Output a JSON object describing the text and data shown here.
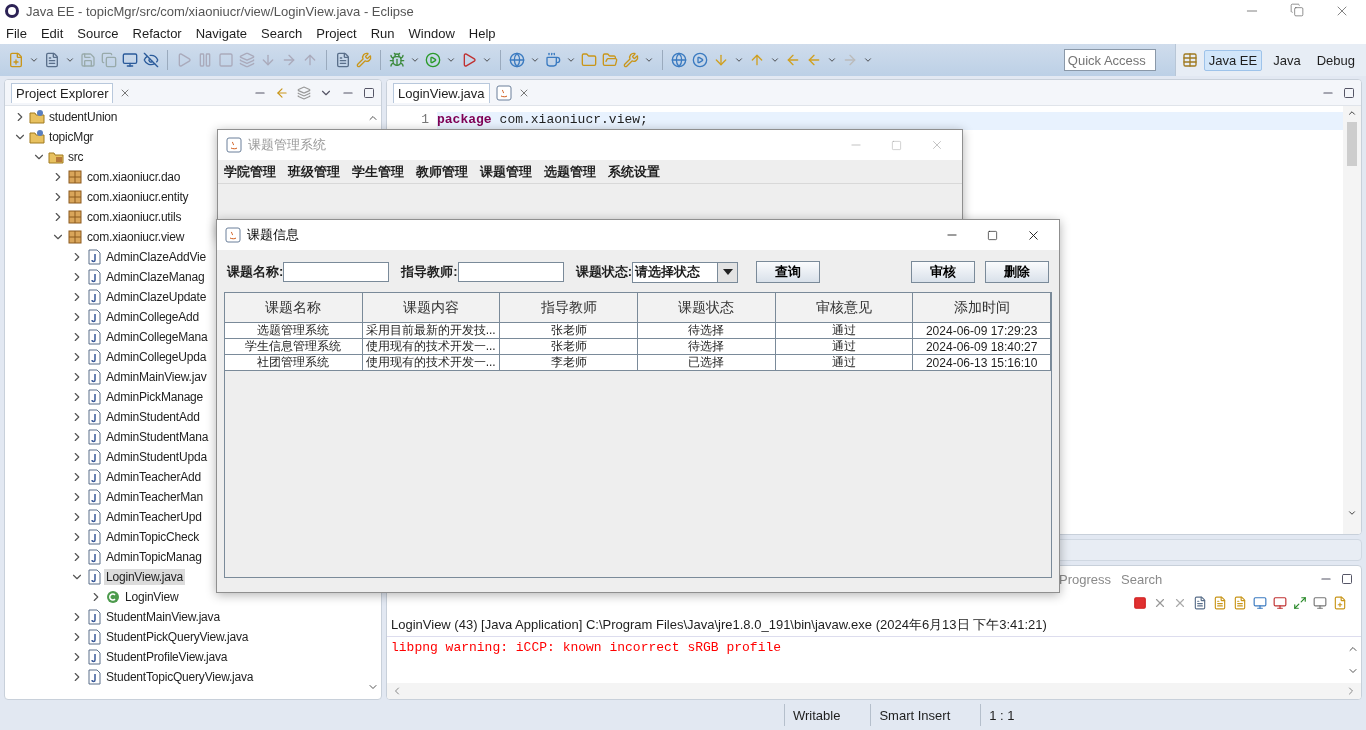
{
  "window": {
    "title": "Java EE - topicMgr/src/com/xiaoniucr/view/LoginView.java - Eclipse"
  },
  "menu": [
    "File",
    "Edit",
    "Source",
    "Refactor",
    "Navigate",
    "Search",
    "Project",
    "Run",
    "Window",
    "Help"
  ],
  "quick_access": {
    "placeholder": "Quick Access"
  },
  "perspectives": [
    {
      "label": "Java EE",
      "selected": true
    },
    {
      "label": "Java",
      "selected": false
    },
    {
      "label": "Debug",
      "selected": false
    }
  ],
  "project_explorer": {
    "title": "Project Explorer",
    "tree": [
      {
        "label": "studentUnion",
        "kind": "project",
        "expanded": false,
        "selected": false
      },
      {
        "label": "topicMgr",
        "kind": "project",
        "expanded": true,
        "selected": false,
        "children": [
          {
            "label": "src",
            "kind": "source-folder",
            "expanded": true,
            "selected": false,
            "children": [
              {
                "label": "com.xiaoniucr.dao",
                "kind": "package",
                "expanded": false,
                "selected": false
              },
              {
                "label": "com.xiaoniucr.entity",
                "kind": "package",
                "expanded": false,
                "selected": false
              },
              {
                "label": "com.xiaoniucr.utils",
                "kind": "package",
                "expanded": false,
                "selected": false
              },
              {
                "label": "com.xiaoniucr.view",
                "kind": "package",
                "expanded": true,
                "selected": false,
                "children": [
                  {
                    "label": "AdminClazeAddVie",
                    "kind": "java-file",
                    "expanded": false,
                    "selected": false
                  },
                  {
                    "label": "AdminClazeManag",
                    "kind": "java-file",
                    "expanded": false,
                    "selected": false
                  },
                  {
                    "label": "AdminClazeUpdate",
                    "kind": "java-file",
                    "expanded": false,
                    "selected": false
                  },
                  {
                    "label": "AdminCollegeAdd",
                    "kind": "java-file",
                    "expanded": false,
                    "selected": false
                  },
                  {
                    "label": "AdminCollegeMana",
                    "kind": "java-file",
                    "expanded": false,
                    "selected": false
                  },
                  {
                    "label": "AdminCollegeUpda",
                    "kind": "java-file",
                    "expanded": false,
                    "selected": false
                  },
                  {
                    "label": "AdminMainView.jav",
                    "kind": "java-file",
                    "expanded": false,
                    "selected": false
                  },
                  {
                    "label": "AdminPickManage",
                    "kind": "java-file",
                    "expanded": false,
                    "selected": false
                  },
                  {
                    "label": "AdminStudentAdd",
                    "kind": "java-file",
                    "expanded": false,
                    "selected": false
                  },
                  {
                    "label": "AdminStudentMana",
                    "kind": "java-file",
                    "expanded": false,
                    "selected": false
                  },
                  {
                    "label": "AdminStudentUpda",
                    "kind": "java-file",
                    "expanded": false,
                    "selected": false
                  },
                  {
                    "label": "AdminTeacherAdd",
                    "kind": "java-file",
                    "expanded": false,
                    "selected": false
                  },
                  {
                    "label": "AdminTeacherMan",
                    "kind": "java-file",
                    "expanded": false,
                    "selected": false
                  },
                  {
                    "label": "AdminTeacherUpd",
                    "kind": "java-file",
                    "expanded": false,
                    "selected": false
                  },
                  {
                    "label": "AdminTopicCheck",
                    "kind": "java-file",
                    "expanded": false,
                    "selected": false
                  },
                  {
                    "label": "AdminTopicManag",
                    "kind": "java-file",
                    "expanded": false,
                    "selected": false
                  },
                  {
                    "label": "LoginView.java",
                    "kind": "java-file",
                    "expanded": true,
                    "selected": true,
                    "children": [
                      {
                        "label": "LoginView",
                        "kind": "class",
                        "expanded": false,
                        "selected": false
                      }
                    ]
                  },
                  {
                    "label": "StudentMainView.java",
                    "kind": "java-file",
                    "expanded": false,
                    "selected": false
                  },
                  {
                    "label": "StudentPickQueryView.java",
                    "kind": "java-file",
                    "expanded": false,
                    "selected": false
                  },
                  {
                    "label": "StudentProfileView.java",
                    "kind": "java-file",
                    "expanded": false,
                    "selected": false
                  },
                  {
                    "label": "StudentTopicQueryView.java",
                    "kind": "java-file",
                    "expanded": false,
                    "selected": false
                  }
                ]
              }
            ]
          }
        ]
      }
    ]
  },
  "editor": {
    "tabs": [
      {
        "label": "LoginView.java",
        "selected": true
      }
    ],
    "lines": [
      {
        "number": "1",
        "keyword": "package",
        "code": "com.xiaoniucr.view;"
      }
    ]
  },
  "console": {
    "tabs": [
      {
        "label": "Progress",
        "selected": false
      },
      {
        "label": "Search",
        "selected": false
      }
    ],
    "process": "LoginView (43) [Java Application] C:\\Program Files\\Java\\jre1.8.0_191\\bin\\javaw.exe (2024年6月13日 下午3:41:21)",
    "output": [
      {
        "text": "libpng warning: iCCP: known incorrect sRGB profile",
        "kind": "error"
      }
    ]
  },
  "status_bar": [
    "Writable",
    "Smart Insert",
    "1 : 1"
  ],
  "app_window": {
    "title": "课题管理系统",
    "active": false,
    "menu": [
      "学院管理",
      "班级管理",
      "学生管理",
      "教师管理",
      "课题管理",
      "选题管理",
      "系统设置"
    ]
  },
  "dialog": {
    "title": "课题信息",
    "active": true,
    "filters": [
      {
        "kind": "text",
        "label": "课题名称:"
      },
      {
        "kind": "text",
        "label": "指导教师:"
      },
      {
        "kind": "select",
        "label": "课题状态:",
        "value": "请选择状态"
      }
    ],
    "search_button": "查询",
    "actions": [
      "审核",
      "删除"
    ],
    "table": {
      "columns": [
        "课题名称",
        "课题内容",
        "指导教师",
        "课题状态",
        "审核意见",
        "添加时间"
      ],
      "rows": [
        [
          "选题管理系统",
          "采用目前最新的开发技...",
          "张老师",
          "待选择",
          "通过",
          "2024-06-09 17:29:23"
        ],
        [
          "学生信息管理系统",
          "使用现有的技术开发一...",
          "张老师",
          "待选择",
          "通过",
          "2024-06-09 18:40:27"
        ],
        [
          "社团管理系统",
          "使用现有的技术开发一...",
          "李老师",
          "已选择",
          "通过",
          "2024-06-13 15:16:10"
        ]
      ]
    }
  }
}
